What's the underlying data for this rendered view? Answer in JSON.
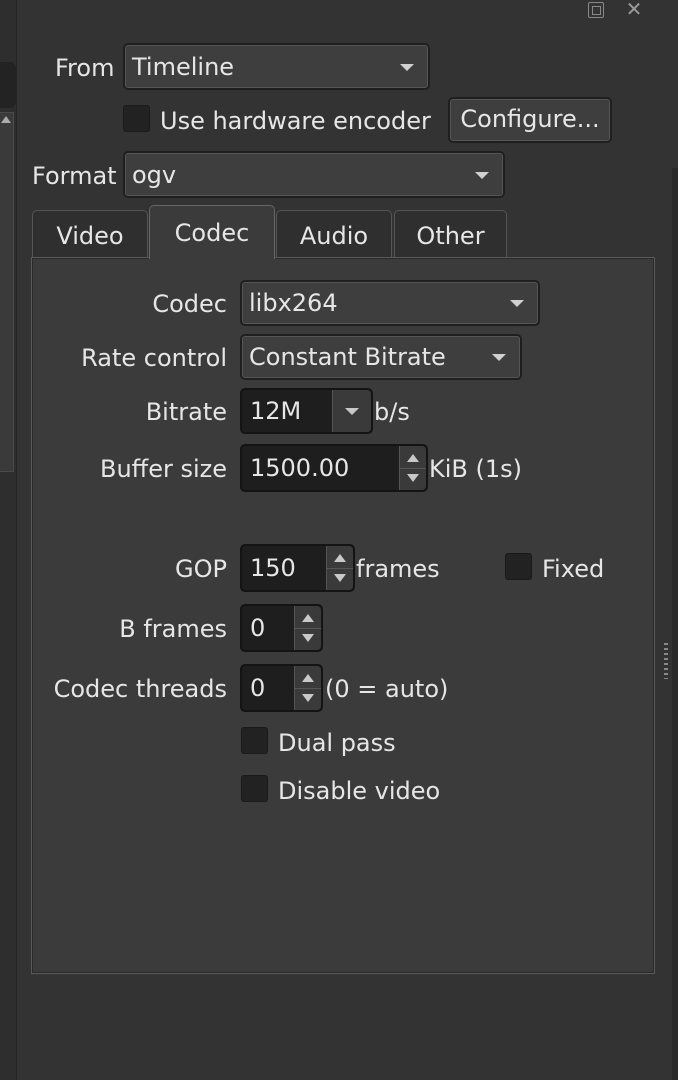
{
  "header": {
    "from_label": "From",
    "from_value": "Timeline",
    "hw_encoder_label": "Use hardware encoder",
    "configure_label": "Configure...",
    "format_label": "Format",
    "format_value": "ogv"
  },
  "tabs": [
    {
      "label": "Video",
      "active": false
    },
    {
      "label": "Codec",
      "active": true
    },
    {
      "label": "Audio",
      "active": false
    },
    {
      "label": "Other",
      "active": false
    }
  ],
  "codec": {
    "codec_label": "Codec",
    "codec_value": "libx264",
    "rate_control_label": "Rate control",
    "rate_control_value": "Constant Bitrate",
    "bitrate_label": "Bitrate",
    "bitrate_value": "12M",
    "bitrate_unit": "b/s",
    "buffer_label": "Buffer size",
    "buffer_value": "1500.00",
    "buffer_unit": "KiB (1s)",
    "gop_label": "GOP",
    "gop_value": "150",
    "gop_unit": "frames",
    "fixed_label": "Fixed",
    "bframes_label": "B frames",
    "bframes_value": "0",
    "threads_label": "Codec threads",
    "threads_value": "0",
    "threads_hint": "(0 = auto)",
    "dual_pass_label": "Dual pass",
    "disable_video_label": "Disable video"
  },
  "colors": {
    "background": "#333333",
    "panel": "#3b3b3b",
    "text": "#e6e6e6",
    "field_dark": "#1e1e1e"
  }
}
